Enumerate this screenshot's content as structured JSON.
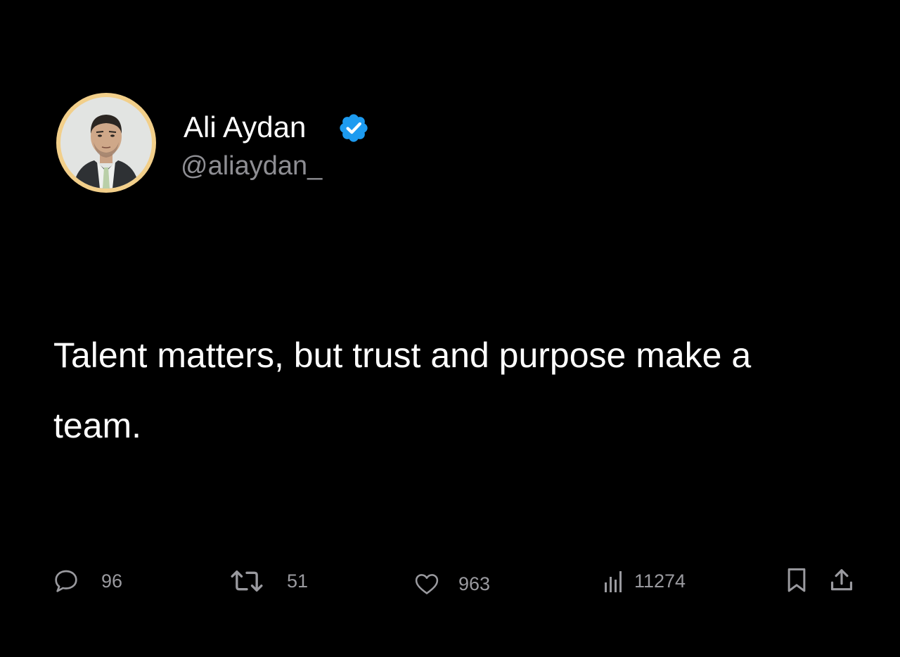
{
  "tweet": {
    "author": {
      "display_name": "Ali Aydan",
      "handle": "@aliaydan_",
      "verified": true,
      "avatar_icon": "profile-photo-icon",
      "avatar_ring_color": "#f2cf8a",
      "verified_color": "#1d9bf0"
    },
    "text": "Talent matters, but trust and purpose make a team.",
    "actions": {
      "replies": {
        "icon": "reply-bubble-icon",
        "count": "96"
      },
      "retweets": {
        "icon": "retweet-icon",
        "count": "51"
      },
      "likes": {
        "icon": "heart-icon",
        "count": "963"
      },
      "views": {
        "icon": "views-chart-icon",
        "count": "11274"
      },
      "bookmark": {
        "icon": "bookmark-icon"
      },
      "share": {
        "icon": "share-upload-icon"
      }
    }
  },
  "theme": {
    "background": "#000000",
    "text_primary": "#ffffff",
    "text_secondary": "#8e8e93",
    "icon_color": "#9a9a9f"
  }
}
